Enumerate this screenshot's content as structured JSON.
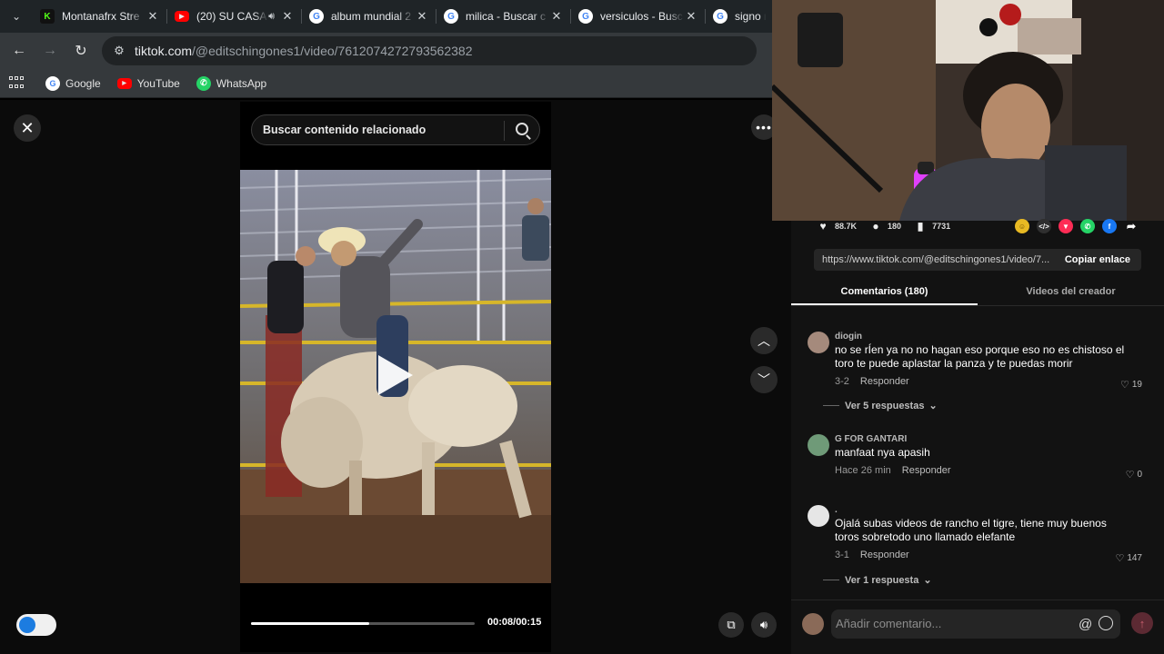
{
  "browser": {
    "tabs": [
      {
        "title": "Montanafrx Stre",
        "icon": "kick-icon",
        "color": "#53fc18"
      },
      {
        "title": "(20) SU CASA",
        "icon": "youtube-icon",
        "color": "#ff0000",
        "audio": true
      },
      {
        "title": "album mundial 2",
        "icon": "google-icon",
        "color": "#4285f4"
      },
      {
        "title": "milica - Buscar c",
        "icon": "google-icon",
        "color": "#4285f4"
      },
      {
        "title": "versiculos - Busc",
        "icon": "google-icon",
        "color": "#4285f4"
      },
      {
        "title": "signo m",
        "icon": "google-icon",
        "color": "#4285f4"
      }
    ],
    "url_host": "tiktok.com",
    "url_path": "/@editschingones1/video/7612074272793562382",
    "bookmarks": [
      {
        "label": "Google",
        "icon": "google-icon"
      },
      {
        "label": "YouTube",
        "icon": "youtube-icon"
      },
      {
        "label": "WhatsApp",
        "icon": "whatsapp-icon"
      }
    ]
  },
  "player": {
    "search_placeholder": "Buscar contenido relacionado",
    "time": "00:08/00:15",
    "progress": 0.53
  },
  "panel": {
    "likes": "88.7K",
    "comments_count": "180",
    "saves": "7731",
    "share_link": "https://www.tiktok.com/@editschingones1/video/7...",
    "copy_label": "Copiar enlace",
    "tab_comments": "Comentarios (180)",
    "tab_creator": "Videos del creador",
    "comments": [
      {
        "user": "diogin",
        "text": "no se rÍen ya no no hagan eso porque eso no es chistoso el toro te puede aplastar la panza y te puedas morir",
        "date": "3-2",
        "reply": "Responder",
        "likes": "19",
        "replies": "Ver 5 respuestas"
      },
      {
        "user": "G FOR GANTARI",
        "text": "manfaat nya apasih",
        "date": "Hace 26 min",
        "reply": "Responder",
        "likes": "0"
      },
      {
        "user": ".",
        "text": "Ojalá subas videos de rancho el tigre, tiene muy buenos toros sobretodo uno llamado elefante",
        "date": "3-1",
        "reply": "Responder",
        "likes": "147",
        "replies": "Ver 1 respuesta"
      }
    ],
    "composer_placeholder": "Añadir comentario...",
    "composer_at": "@"
  }
}
